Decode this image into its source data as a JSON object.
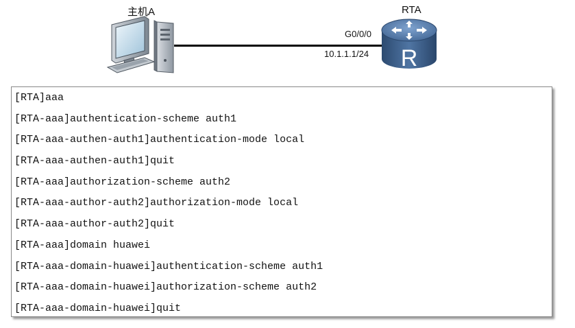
{
  "topology": {
    "host_label": "主机A",
    "router_label": "RTA",
    "interface_label": "G0/0/0",
    "ip_label": "10.1.1.1/24",
    "host_icon": "desktop-computer-icon",
    "router_icon": "router-icon"
  },
  "console": {
    "lines": [
      "[RTA]aaa",
      "[RTA-aaa]authentication-scheme auth1",
      "[RTA-aaa-authen-auth1]authentication-mode local",
      "[RTA-aaa-authen-auth1]quit",
      "[RTA-aaa]authorization-scheme auth2",
      "[RTA-aaa-author-auth2]authorization-mode local",
      "[RTA-aaa-author-auth2]quit",
      "[RTA-aaa]domain huawei",
      "[RTA-aaa-domain-huawei]authentication-scheme auth1",
      "[RTA-aaa-domain-huawei]authorization-scheme auth2",
      "[RTA-aaa-domain-huawei]quit"
    ]
  }
}
